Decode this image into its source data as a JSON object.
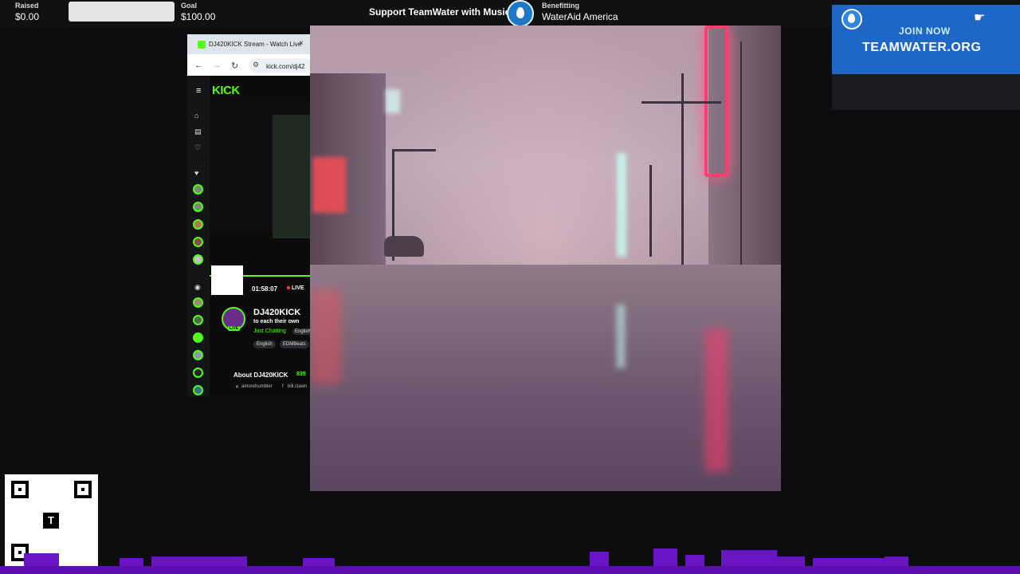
{
  "donation_bar": {
    "raised_label": "Raised",
    "raised_value": "$0.00",
    "goal_label": "Goal",
    "goal_value": "$100.00",
    "progress": 0,
    "title": "Support TeamWater with Music",
    "benefit_label": "Benefitting",
    "benefit_value": "WaterAid America"
  },
  "teamwater_banner": {
    "join": "JOIN NOW",
    "url": "TEAMWATER.ORG"
  },
  "browser": {
    "tab_title": "DJ420KICK Stream - Watch Live",
    "url": "kick.com/dj42",
    "close": "×",
    "kick": {
      "logo": "KICK",
      "timer": "01:58:07",
      "live": "LIVE",
      "channel_name": "DJ420KICK",
      "bio": "to each their own",
      "category": "Just Chatting",
      "language_chip": "English",
      "tags": [
        "English",
        "EDMBeats"
      ],
      "avatar_badge": "LIVE",
      "about_title": "About DJ420KICK",
      "followers": "835",
      "socials": [
        "amorehumbler",
        "bill.clawn"
      ]
    }
  },
  "qr_center_letter": "T",
  "colors": {
    "kick_green": "#53fc18",
    "teamwater_blue": "#1f67c7",
    "equalizer_purple": "#6a14c8"
  }
}
